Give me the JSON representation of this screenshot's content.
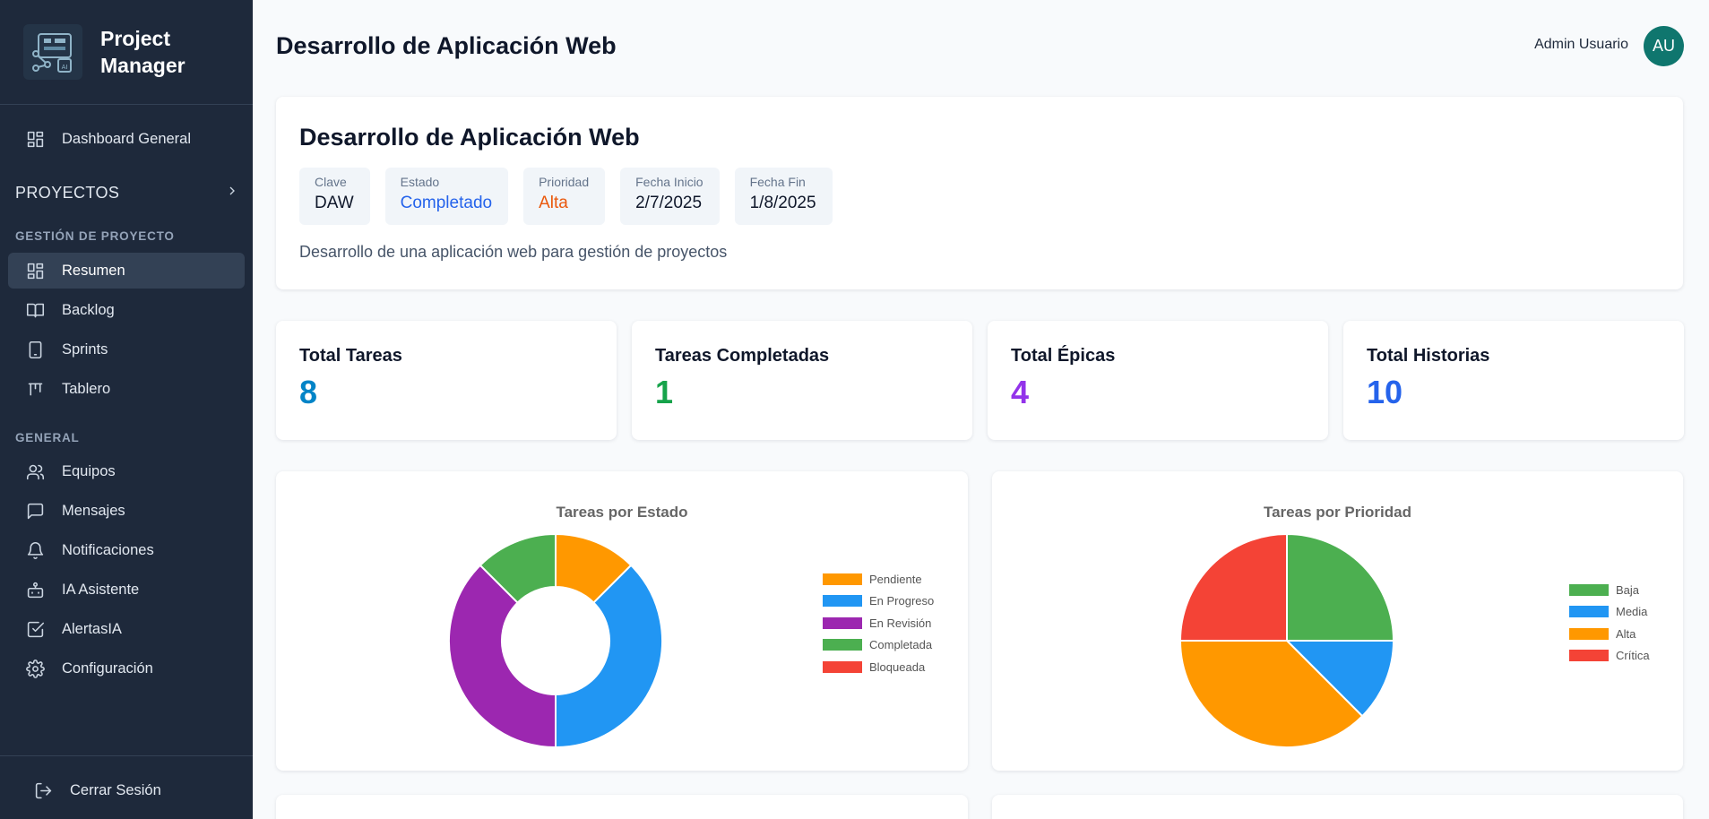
{
  "brand": {
    "title": "Project Manager",
    "logo_icon": "ai-chip-network-icon"
  },
  "sidebar": {
    "dashboard": {
      "label": "Dashboard General",
      "icon": "grid-icon"
    },
    "projects_header": "PROYECTOS",
    "section_gestion": "GESTIÓN DE PROYECTO",
    "gestion_items": [
      {
        "label": "Resumen",
        "icon": "grid-icon",
        "active": true
      },
      {
        "label": "Backlog",
        "icon": "book-icon"
      },
      {
        "label": "Sprints",
        "icon": "tablet-icon"
      },
      {
        "label": "Tablero",
        "icon": "kanban-icon"
      }
    ],
    "section_general": "GENERAL",
    "general_items": [
      {
        "label": "Equipos",
        "icon": "users-icon"
      },
      {
        "label": "Mensajes",
        "icon": "message-icon"
      },
      {
        "label": "Notificaciones",
        "icon": "bell-icon"
      },
      {
        "label": "IA Asistente",
        "icon": "bot-icon"
      },
      {
        "label": "AlertasIA",
        "icon": "check-square-icon"
      },
      {
        "label": "Configuración",
        "icon": "gear-icon"
      }
    ],
    "logout": {
      "label": "Cerrar Sesión",
      "icon": "logout-icon"
    }
  },
  "header": {
    "title": "Desarrollo de Aplicación Web",
    "user_name": "Admin Usuario",
    "avatar_initials": "AU"
  },
  "project": {
    "title": "Desarrollo de Aplicación Web",
    "meta": [
      {
        "label": "Clave",
        "value": "DAW",
        "color": "#0f172a"
      },
      {
        "label": "Estado",
        "value": "Completado",
        "color": "#2563eb"
      },
      {
        "label": "Prioridad",
        "value": "Alta",
        "color": "#ea580c"
      },
      {
        "label": "Fecha Inicio",
        "value": "2/7/2025",
        "color": "#0f172a"
      },
      {
        "label": "Fecha Fin",
        "value": "1/8/2025",
        "color": "#0f172a"
      }
    ],
    "description": "Desarrollo de una aplicación web para gestión de proyectos"
  },
  "stats": [
    {
      "label": "Total Tareas",
      "value": "8",
      "color": "#0284c7"
    },
    {
      "label": "Tareas Completadas",
      "value": "1",
      "color": "#16a34a"
    },
    {
      "label": "Total Épicas",
      "value": "4",
      "color": "#9333ea"
    },
    {
      "label": "Total Historias",
      "value": "10",
      "color": "#2563eb"
    }
  ],
  "chart_data": [
    {
      "type": "pie",
      "variant": "doughnut",
      "title": "Tareas por Estado",
      "categories": [
        "Pendiente",
        "En Progreso",
        "En Revisión",
        "Completada",
        "Bloqueada"
      ],
      "values": [
        1,
        3,
        3,
        1,
        0
      ],
      "colors": [
        "#FF9800",
        "#2196F3",
        "#9C27B0",
        "#4CAF50",
        "#F44336"
      ],
      "legend_position": "right"
    },
    {
      "type": "pie",
      "title": "Tareas por Prioridad",
      "categories": [
        "Baja",
        "Media",
        "Alta",
        "Crítica"
      ],
      "values": [
        2,
        1,
        3,
        2
      ],
      "colors": [
        "#4CAF50",
        "#2196F3",
        "#FF9800",
        "#F44336"
      ],
      "legend_position": "right"
    }
  ]
}
